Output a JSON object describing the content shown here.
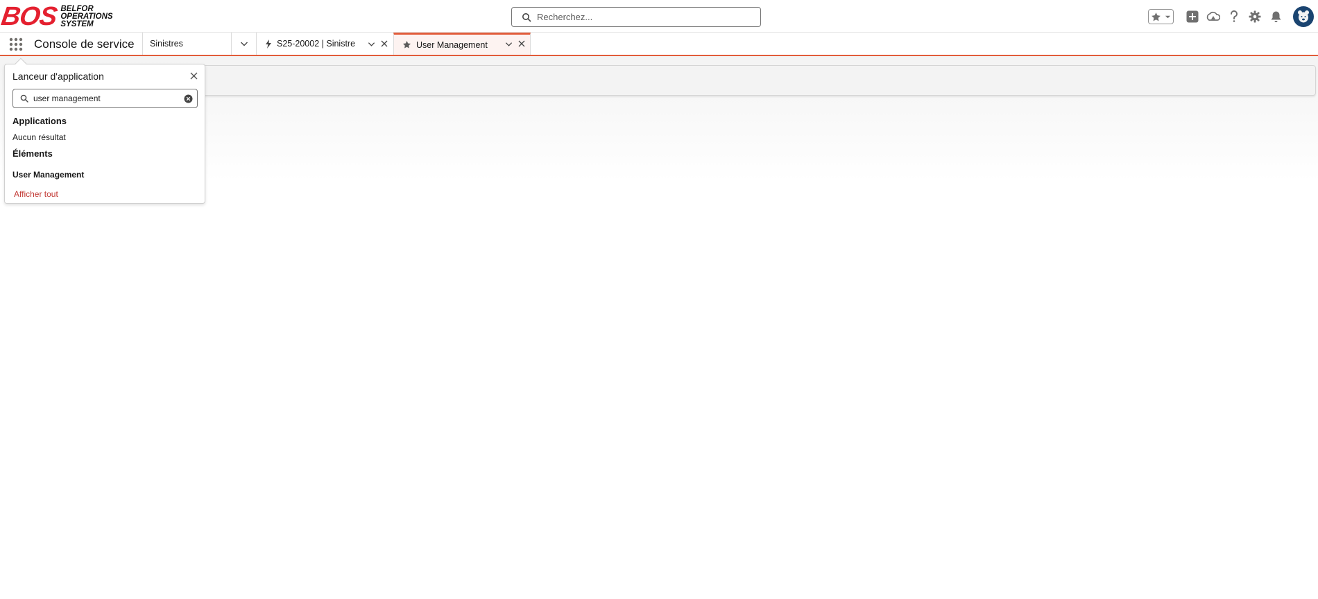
{
  "brand": {
    "logo_mark": "BOS",
    "logo_lines": [
      "BELFOR",
      "OPERATIONS",
      "SYSTEM"
    ]
  },
  "global_search": {
    "placeholder": "Recherchez..."
  },
  "header_icons": [
    "favorites-star-icon",
    "chevron-down-icon",
    "global-create-icon",
    "trailhead-icon",
    "help-icon",
    "setup-gear-icon",
    "notifications-bell-icon",
    "user-avatar"
  ],
  "nav": {
    "app_name": "Console de service",
    "tabs": [
      {
        "label": "Sinistres",
        "icon": ""
      },
      {
        "label": "S25-20002 | Sinistre",
        "icon": "lightning-icon"
      },
      {
        "label": "User Management",
        "icon": "star-icon",
        "active": true
      }
    ]
  },
  "launcher": {
    "title": "Lanceur d'application",
    "search_value": "user management",
    "apps_heading": "Applications",
    "apps_empty": "Aucun résultat",
    "items_heading": "Éléments",
    "items": [
      "User Management"
    ],
    "show_all": "Afficher tout"
  },
  "colors": {
    "brand_red": "#e4202f",
    "accent": "#e25c3a",
    "link": "#c23934",
    "avatar_bg": "#1a4470"
  }
}
